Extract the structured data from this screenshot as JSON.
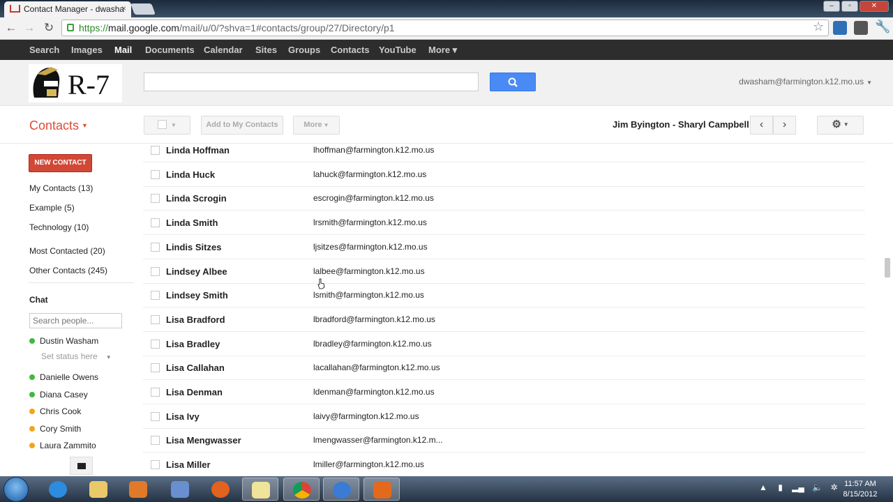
{
  "browser": {
    "tab_title": "Contact Manager - dwasha",
    "tab_close": "×",
    "url_scheme": "https://",
    "url_domain": "mail.google.com",
    "url_path": "/mail/u/0/?shva=1#contacts/group/27/Directory/p1"
  },
  "gbar": [
    "Search",
    "Images",
    "Mail",
    "Documents",
    "Calendar",
    "Sites",
    "Groups",
    "Contacts",
    "YouTube",
    "More ▾"
  ],
  "header": {
    "logo_text": "R-7",
    "account": "dwasham@farmington.k12.mo.us"
  },
  "actions": {
    "title": "Contacts",
    "add_to_my_contacts": "Add to My Contacts",
    "more": "More",
    "range": "Jim Byington - Sharyl Campbell"
  },
  "sidebar": {
    "new_contact": "NEW CONTACT",
    "groups": [
      "My Contacts (13)",
      "Example (5)",
      "Technology (10)",
      "Most Contacted (20)",
      "Other Contacts (245)"
    ],
    "chat_heading": "Chat",
    "search_placeholder": "Search people...",
    "me": "Dustin Washam",
    "status": "Set status here",
    "buddies": [
      {
        "name": "Danielle Owens",
        "status": "available"
      },
      {
        "name": "Diana Casey",
        "status": "available"
      },
      {
        "name": "Chris Cook",
        "status": "idle"
      },
      {
        "name": "Cory Smith",
        "status": "idle"
      },
      {
        "name": "Laura Zammito",
        "status": "idle"
      }
    ]
  },
  "contacts": [
    {
      "name": "Linda Hoffman",
      "email": "lhoffman@farmington.k12.mo.us"
    },
    {
      "name": "Linda Huck",
      "email": "lahuck@farmington.k12.mo.us"
    },
    {
      "name": "Linda Scrogin",
      "email": "escrogin@farmington.k12.mo.us"
    },
    {
      "name": "Linda Smith",
      "email": "lrsmith@farmington.k12.mo.us"
    },
    {
      "name": "Lindis Sitzes",
      "email": "ljsitzes@farmington.k12.mo.us"
    },
    {
      "name": "Lindsey Albee",
      "email": "lalbee@farmington.k12.mo.us"
    },
    {
      "name": "Lindsey Smith",
      "email": "lsmith@farmington.k12.mo.us"
    },
    {
      "name": "Lisa Bradford",
      "email": "lbradford@farmington.k12.mo.us"
    },
    {
      "name": "Lisa Bradley",
      "email": "lbradley@farmington.k12.mo.us"
    },
    {
      "name": "Lisa Callahan",
      "email": "lacallahan@farmington.k12.mo.us"
    },
    {
      "name": "Lisa Denman",
      "email": "ldenman@farmington.k12.mo.us"
    },
    {
      "name": "Lisa Ivy",
      "email": "laivy@farmington.k12.mo.us"
    },
    {
      "name": "Lisa Mengwasser",
      "email": "lmengwasser@farmington.k12.m..."
    },
    {
      "name": "Lisa Miller",
      "email": "lmiller@farmington.k12.mo.us"
    }
  ],
  "taskbar": {
    "time": "11:57 AM",
    "date": "8/15/2012"
  }
}
